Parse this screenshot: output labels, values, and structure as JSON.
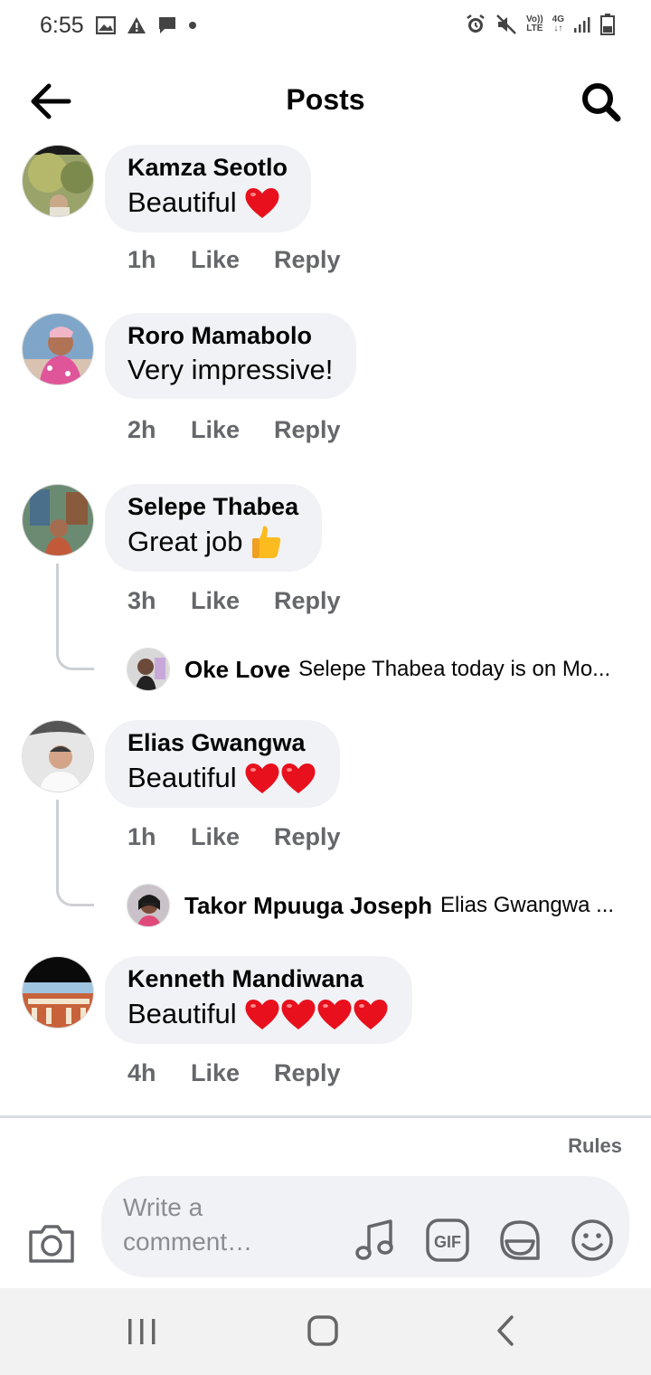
{
  "status_bar": {
    "time": "6:55",
    "volte_top": "Vo))",
    "volte_bottom": "LTE",
    "network_top": "4G",
    "network_bottom": "↓↑"
  },
  "header": {
    "title": "Posts"
  },
  "comments": [
    {
      "author": "Kamza Seotlo",
      "text": "Beautiful",
      "emoji": "red-heart",
      "emoji_count": 1,
      "time": "1h",
      "like": "Like",
      "reply": "Reply"
    },
    {
      "author": "Roro Mamabolo",
      "text": "Very impressive!",
      "emoji": "",
      "emoji_count": 0,
      "time": "2h",
      "like": "Like",
      "reply": "Reply"
    },
    {
      "author": "Selepe Thabea",
      "text": "Great job",
      "emoji": "thumbs-up",
      "emoji_count": 1,
      "time": "3h",
      "like": "Like",
      "reply": "Reply",
      "reply_preview": {
        "author": "Oke Love",
        "text": "Selepe Thabea today is on Mo..."
      }
    },
    {
      "author": "Elias Gwangwa",
      "text": "Beautiful",
      "emoji": "red-heart",
      "emoji_count": 2,
      "time": "1h",
      "like": "Like",
      "reply": "Reply",
      "reply_preview": {
        "author": "Takor Mpuuga Joseph",
        "text": "Elias Gwangwa ..."
      }
    },
    {
      "author": "Kenneth Mandiwana",
      "text": "Beautiful",
      "emoji": "red-heart",
      "emoji_count": 4,
      "time": "4h",
      "like": "Like",
      "reply": "Reply"
    }
  ],
  "footer": {
    "rules": "Rules",
    "composer_placeholder": "Write a comment…",
    "gif_label": "GIF"
  },
  "colors": {
    "bubble": "#f0f2f5",
    "meta_text": "#65676b",
    "heart": "#e8101d",
    "thumb": "#fcbc20"
  }
}
